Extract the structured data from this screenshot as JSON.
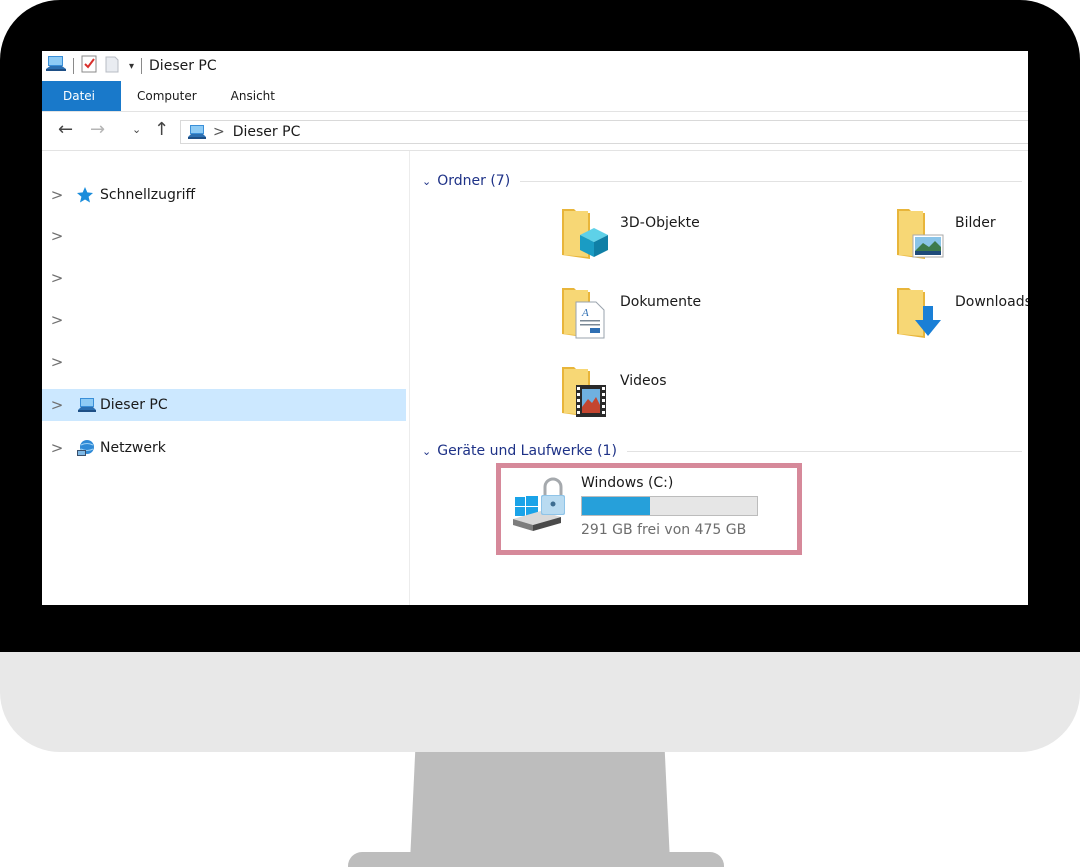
{
  "window": {
    "title": "Dieser PC"
  },
  "ribbon": {
    "tabs": [
      "Datei",
      "Computer",
      "Ansicht"
    ]
  },
  "address": {
    "path_label": "Dieser PC",
    "separator": ">"
  },
  "navpane": {
    "items": [
      {
        "label": "Schnellzugriff"
      },
      {
        "label": ""
      },
      {
        "label": ""
      },
      {
        "label": ""
      },
      {
        "label": ""
      },
      {
        "label": "Dieser PC",
        "selected": true
      },
      {
        "label": "Netzwerk"
      }
    ]
  },
  "content": {
    "folders_header": "Ordner (7)",
    "folders": [
      "3D-Objekte",
      "Bilder",
      "Dokumente",
      "Downloads",
      "Videos"
    ],
    "devices_header": "Geräte und Laufwerke (1)",
    "drive": {
      "name": "Windows (C:)",
      "free_text": "291 GB frei von 475 GB",
      "used_fraction": 0.387
    }
  },
  "colors": {
    "accent": "#1979ca",
    "selection": "#cce8ff",
    "group_header": "#1e3287",
    "drive_bar": "#26a0da",
    "highlight_border": "#d6899a"
  },
  "icons": [
    "computer-icon",
    "properties-icon",
    "new-folder-icon",
    "dropdown-icon",
    "back-arrow-icon",
    "forward-arrow-icon",
    "recent-dropdown-icon",
    "up-arrow-icon",
    "star-icon",
    "network-icon",
    "folder-3d-icon",
    "folder-pictures-icon",
    "folder-documents-icon",
    "folder-downloads-icon",
    "folder-videos-icon",
    "drive-windows-lock-icon"
  ]
}
